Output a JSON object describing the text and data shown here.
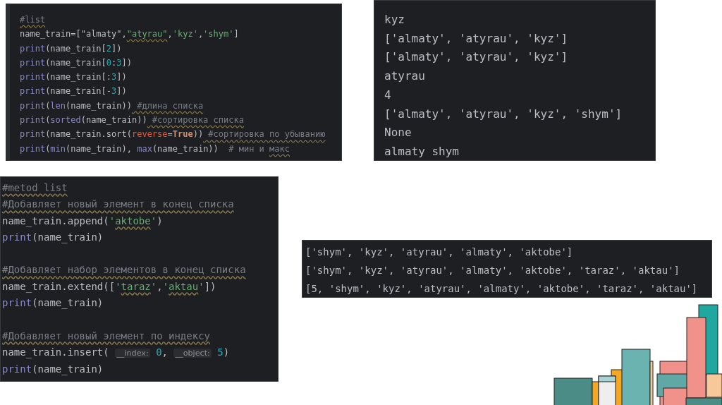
{
  "editor_top": {
    "lines": [
      {
        "tokens": [
          {
            "kind": "comment-typo",
            "text": "#list"
          }
        ]
      },
      {
        "tokens": [
          {
            "kind": "plain",
            "text": "name_train=[\"almaty\","
          },
          {
            "kind": "string-typo",
            "text": "\"atyrau\""
          },
          {
            "kind": "plain",
            "text": ","
          },
          {
            "kind": "string",
            "text": "'kyz'"
          },
          {
            "kind": "plain",
            "text": ","
          },
          {
            "kind": "string",
            "text": "'shym'"
          },
          {
            "kind": "plain",
            "text": "]"
          }
        ]
      },
      {
        "tokens": [
          {
            "kind": "builtin",
            "text": "print"
          },
          {
            "kind": "plain",
            "text": "(name_train["
          },
          {
            "kind": "number",
            "text": "2"
          },
          {
            "kind": "plain",
            "text": "])"
          }
        ]
      },
      {
        "tokens": [
          {
            "kind": "builtin",
            "text": "print"
          },
          {
            "kind": "plain",
            "text": "(name_train["
          },
          {
            "kind": "number",
            "text": "0"
          },
          {
            "kind": "plain",
            "text": ":"
          },
          {
            "kind": "number",
            "text": "3"
          },
          {
            "kind": "plain",
            "text": "])"
          }
        ]
      },
      {
        "tokens": [
          {
            "kind": "builtin",
            "text": "print"
          },
          {
            "kind": "plain",
            "text": "(name_train[:"
          },
          {
            "kind": "number",
            "text": "3"
          },
          {
            "kind": "plain",
            "text": "])"
          }
        ]
      },
      {
        "tokens": [
          {
            "kind": "builtin",
            "text": "print"
          },
          {
            "kind": "plain",
            "text": "(name_train[-"
          },
          {
            "kind": "number",
            "text": "3"
          },
          {
            "kind": "plain",
            "text": "])"
          }
        ]
      },
      {
        "tokens": [
          {
            "kind": "builtin",
            "text": "print"
          },
          {
            "kind": "plain",
            "text": "("
          },
          {
            "kind": "builtin",
            "text": "len"
          },
          {
            "kind": "plain",
            "text": "(name_train))"
          },
          {
            "kind": "comment-typo",
            "text": " #длина списка"
          }
        ]
      },
      {
        "tokens": [
          {
            "kind": "builtin",
            "text": "print"
          },
          {
            "kind": "plain",
            "text": "("
          },
          {
            "kind": "builtin",
            "text": "sorted"
          },
          {
            "kind": "plain",
            "text": "(name_train))"
          },
          {
            "kind": "comment-typo",
            "text": " #сортировка списка"
          }
        ]
      },
      {
        "tokens": [
          {
            "kind": "builtin",
            "text": "print"
          },
          {
            "kind": "plain",
            "text": "(name_train.sort("
          },
          {
            "kind": "param",
            "text": "reverse"
          },
          {
            "kind": "plain",
            "text": "="
          },
          {
            "kind": "constant",
            "text": "True"
          },
          {
            "kind": "plain",
            "text": "))"
          },
          {
            "kind": "comment-typo",
            "text": " #сортировка по убыванию"
          }
        ]
      },
      {
        "tokens": [
          {
            "kind": "builtin",
            "text": "print"
          },
          {
            "kind": "plain",
            "text": "("
          },
          {
            "kind": "builtin",
            "text": "min"
          },
          {
            "kind": "plain",
            "text": "(name_train), "
          },
          {
            "kind": "builtin",
            "text": "max"
          },
          {
            "kind": "plain",
            "text": "(name_train))  "
          },
          {
            "kind": "comment",
            "text": "# мин и "
          },
          {
            "kind": "comment-typo",
            "text": "макс"
          }
        ]
      }
    ]
  },
  "console_top": {
    "lines": [
      "kyz",
      "['almaty', 'atyrau', 'kyz']",
      "['almaty', 'atyrau', 'kyz']",
      "atyrau",
      "4",
      "['almaty', 'atyrau', 'kyz', 'shym']",
      "None",
      "almaty shym"
    ]
  },
  "editor_bottom": {
    "blocks": [
      [
        {
          "tokens": [
            {
              "kind": "comment-typo",
              "text": "#metod list"
            }
          ]
        },
        {
          "tokens": [
            {
              "kind": "comment-typo",
              "text": "#Добавляет новый элемент в конец списка"
            }
          ]
        },
        {
          "tokens": [
            {
              "kind": "plain",
              "text": "name_train.append("
            },
            {
              "kind": "string",
              "text": "'"
            },
            {
              "kind": "string-typo",
              "text": "aktobe"
            },
            {
              "kind": "string",
              "text": "'"
            },
            {
              "kind": "plain",
              "text": ")"
            }
          ]
        },
        {
          "tokens": [
            {
              "kind": "builtin",
              "text": "print"
            },
            {
              "kind": "plain",
              "text": "(name_train)"
            }
          ]
        }
      ],
      [
        {
          "tokens": [
            {
              "kind": "comment-typo",
              "text": "#Добавляет набор элементов в конец списка"
            }
          ]
        },
        {
          "tokens": [
            {
              "kind": "plain",
              "text": "name_train.extend(["
            },
            {
              "kind": "string",
              "text": "'"
            },
            {
              "kind": "string-typo",
              "text": "taraz"
            },
            {
              "kind": "string",
              "text": "'"
            },
            {
              "kind": "plain",
              "text": ","
            },
            {
              "kind": "string",
              "text": "'"
            },
            {
              "kind": "string-typo",
              "text": "aktau"
            },
            {
              "kind": "string",
              "text": "'"
            },
            {
              "kind": "plain",
              "text": "])"
            }
          ]
        },
        {
          "tokens": [
            {
              "kind": "builtin",
              "text": "print"
            },
            {
              "kind": "plain",
              "text": "(name_train)"
            }
          ]
        }
      ],
      [
        {
          "tokens": [
            {
              "kind": "comment-typo",
              "text": "#Добавляет новый элемент по индексу"
            }
          ]
        },
        {
          "tokens": [
            {
              "kind": "plain",
              "text": "name_train.insert( "
            },
            {
              "kind": "hint",
              "text": "__index:"
            },
            {
              "kind": "number",
              "text": " 0"
            },
            {
              "kind": "plain",
              "text": ", "
            },
            {
              "kind": "hint",
              "text": "__object:"
            },
            {
              "kind": "number",
              "text": " 5"
            },
            {
              "kind": "plain",
              "text": ")"
            }
          ]
        },
        {
          "tokens": [
            {
              "kind": "builtin",
              "text": "print"
            },
            {
              "kind": "plain",
              "text": "(name_train)"
            }
          ]
        }
      ]
    ]
  },
  "console_bottom": {
    "lines": [
      "['shym', 'kyz', 'atyrau', 'almaty', 'aktobe']",
      "['shym', 'kyz', 'atyrau', 'almaty', 'aktobe', 'taraz', 'aktau']",
      "[5, 'shym', 'kyz', 'atyrau', 'almaty', 'aktobe', 'taraz', 'aktau']"
    ]
  }
}
